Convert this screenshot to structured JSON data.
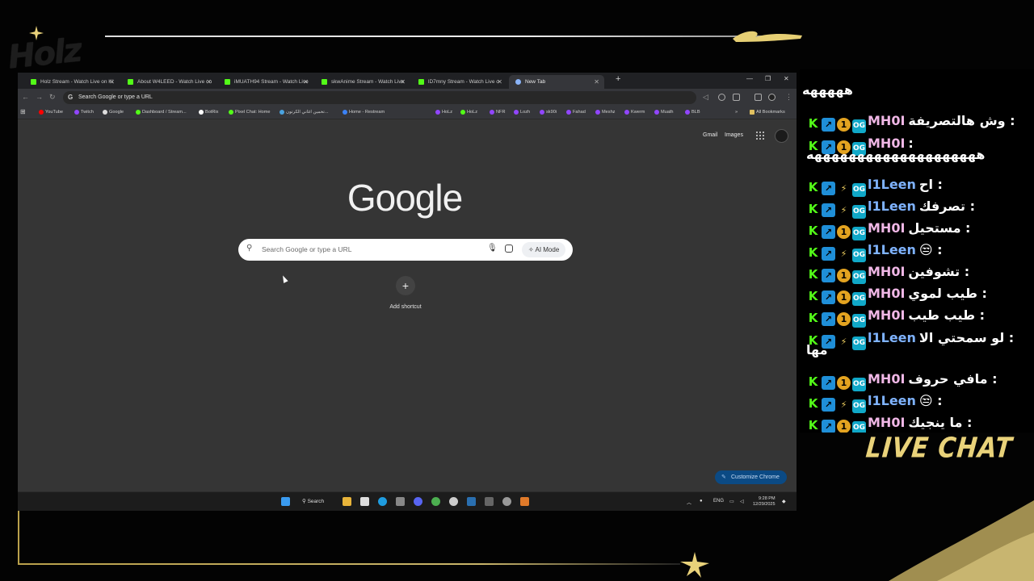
{
  "overlay": {
    "logo_text": "Holz",
    "live_chat_label": "LIVE CHAT"
  },
  "browser": {
    "tabs": [
      {
        "label": "Holz Stream - Watch Live on Ki",
        "active": false
      },
      {
        "label": "About W4LEED - Watch Live on",
        "active": false
      },
      {
        "label": "iMUATH94 Stream - Watch Live",
        "active": false
      },
      {
        "label": "skwAnime Stream - Watch Live",
        "active": false
      },
      {
        "label": "lD7mny Stream - Watch Live o",
        "active": false
      },
      {
        "label": "New Tab",
        "active": true
      }
    ],
    "omnibox_placeholder": "Search Google or type a URL",
    "bookmarks": [
      "YouTube",
      "Twitch",
      "Google",
      "Dashboard / Stream...",
      "BotRix",
      "Pixel Chat: Home",
      "تخمين اغاني الكرتون...",
      "Home - Restream",
      "HoLz",
      "HoLz",
      "NFR",
      "Lozh",
      "sk90i",
      "Fahad",
      "Meshz",
      "Kwerm",
      "Muath",
      "BLB"
    ],
    "all_bookmarks": "All Bookmarks"
  },
  "newtab": {
    "gmail": "Gmail",
    "images": "Images",
    "logo": "Google",
    "search_placeholder": "Search Google or type a URL",
    "ai_mode": "AI Mode",
    "add_shortcut": "Add shortcut",
    "customize": "Customize Chrome"
  },
  "taskbar": {
    "search": "Search",
    "lang": "ENG",
    "time": "9:28 PM",
    "date": "12/29/2025"
  },
  "chat": {
    "top_line": "هههههه",
    "messages": [
      {
        "user": "MH0I",
        "badges": [
          "kick",
          "mod",
          "one",
          "og"
        ],
        "text": ": وش هالتصريفة"
      },
      {
        "user": "MH0I",
        "badges": [
          "kick",
          "mod",
          "one",
          "og"
        ],
        "text": ":"
      },
      {
        "user": "l1Leen",
        "badges": [
          "kick",
          "mod",
          "bolt",
          "og"
        ],
        "text": ": اح"
      },
      {
        "user": "l1Leen",
        "badges": [
          "kick",
          "mod",
          "bolt",
          "og"
        ],
        "text": ": تصرفك"
      },
      {
        "user": "MH0I",
        "badges": [
          "kick",
          "mod",
          "one",
          "og"
        ],
        "text": ": مستحيل"
      },
      {
        "user": "l1Leen",
        "badges": [
          "kick",
          "mod",
          "bolt",
          "og"
        ],
        "text": ": 😒"
      },
      {
        "user": "MH0I",
        "badges": [
          "kick",
          "mod",
          "one",
          "og"
        ],
        "text": ": تشوفين"
      },
      {
        "user": "MH0I",
        "badges": [
          "kick",
          "mod",
          "one",
          "og"
        ],
        "text": ": طيب لموي"
      },
      {
        "user": "MH0I",
        "badges": [
          "kick",
          "mod",
          "one",
          "og"
        ],
        "text": ": طيب طيب"
      },
      {
        "user": "l1Leen",
        "badges": [
          "kick",
          "mod",
          "bolt",
          "og"
        ],
        "text": ": لو سمحتي الا"
      },
      {
        "user": "MH0I",
        "badges": [
          "kick",
          "mod",
          "one",
          "og"
        ],
        "text": ": مافي حروف"
      },
      {
        "user": "l1Leen",
        "badges": [
          "kick",
          "mod",
          "bolt",
          "og"
        ],
        "text": ": 😒"
      },
      {
        "user": "MH0I",
        "badges": [
          "kick",
          "mod",
          "one",
          "og"
        ],
        "text": ": ما ينجيك"
      }
    ],
    "wrap_1": "ههههههههههههههههههههه",
    "wrap_2": "مها"
  },
  "colors": {
    "kick_green": "#53fc18",
    "gold": "#e9d27a",
    "chrome_dark": "#35363a",
    "customize_blue": "#0b4a84"
  }
}
